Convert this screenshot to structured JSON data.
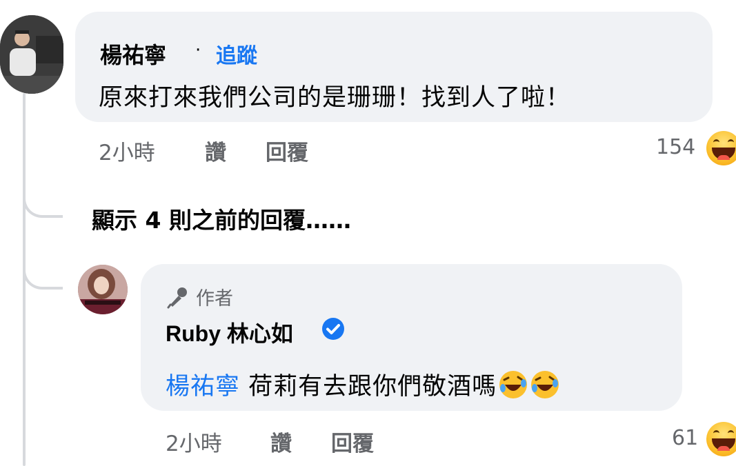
{
  "comment": {
    "author": "楊祐寧",
    "separator": "·",
    "follow_label": "追蹤",
    "text": "原來打來我們公司的是珊珊！找到人了啦！",
    "time": "2小時",
    "like_label": "讚",
    "reply_label": "回覆",
    "reaction_count": "154",
    "reaction_icon": "laugh-emoji"
  },
  "show_previous_replies": "顯示 4 則之前的回覆……",
  "reply": {
    "badge_label": "作者",
    "badge_icon": "microphone-icon",
    "author": "Ruby 林心如",
    "verified_icon": "verified-badge",
    "mention": "楊祐寧",
    "text": "荷莉有去跟你們敬酒嗎",
    "emojis": [
      "rofl-emoji",
      "rofl-emoji"
    ],
    "time": "2小時",
    "like_label": "讚",
    "reply_label": "回覆",
    "reaction_count": "61",
    "reaction_icon": "laugh-emoji"
  },
  "colors": {
    "link_blue": "#1877f2",
    "bubble_bg": "#f0f2f5",
    "meta_gray": "#65676b",
    "thread_line": "#d7d9dd"
  }
}
